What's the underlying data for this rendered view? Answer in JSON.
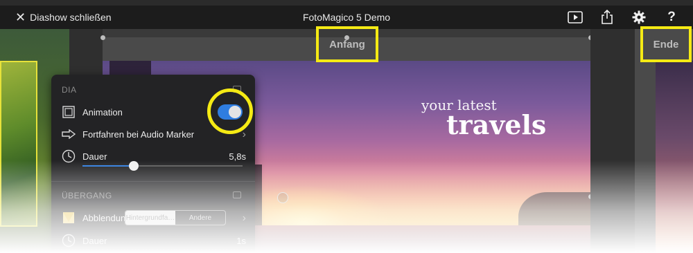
{
  "app": {
    "title": "FotoMagico 5 Demo"
  },
  "toolbar": {
    "close_label": "Diashow schließen",
    "icons": [
      "play-icon",
      "share-icon",
      "gear-icon",
      "help-icon"
    ],
    "help_glyph": "?"
  },
  "stage": {
    "start_label": "Anfang",
    "end_label": "Ende",
    "slide_text_line1": "your latest",
    "slide_text_line2": "travels"
  },
  "panel": {
    "dia": {
      "header": "DIA",
      "animation_label": "Animation",
      "animation_enabled": true,
      "audio_marker_label": "Fortfahren bei Audio Marker",
      "duration_label": "Dauer",
      "duration_value": "5,8s",
      "duration_fraction": 0.32
    },
    "transition": {
      "header": "ÜBERGANG",
      "type_label": "Abblendung",
      "segment_options": [
        "Hintergrundfa…",
        "Andere"
      ],
      "selected_segment": "Hintergrundfa…",
      "duration_label": "Dauer",
      "duration_value": "1s"
    }
  },
  "colors": {
    "accent": "#2f7de0",
    "highlight": "#f5ea14",
    "panel_bg": "#232325",
    "topbar_bg": "#1c1c1c"
  }
}
